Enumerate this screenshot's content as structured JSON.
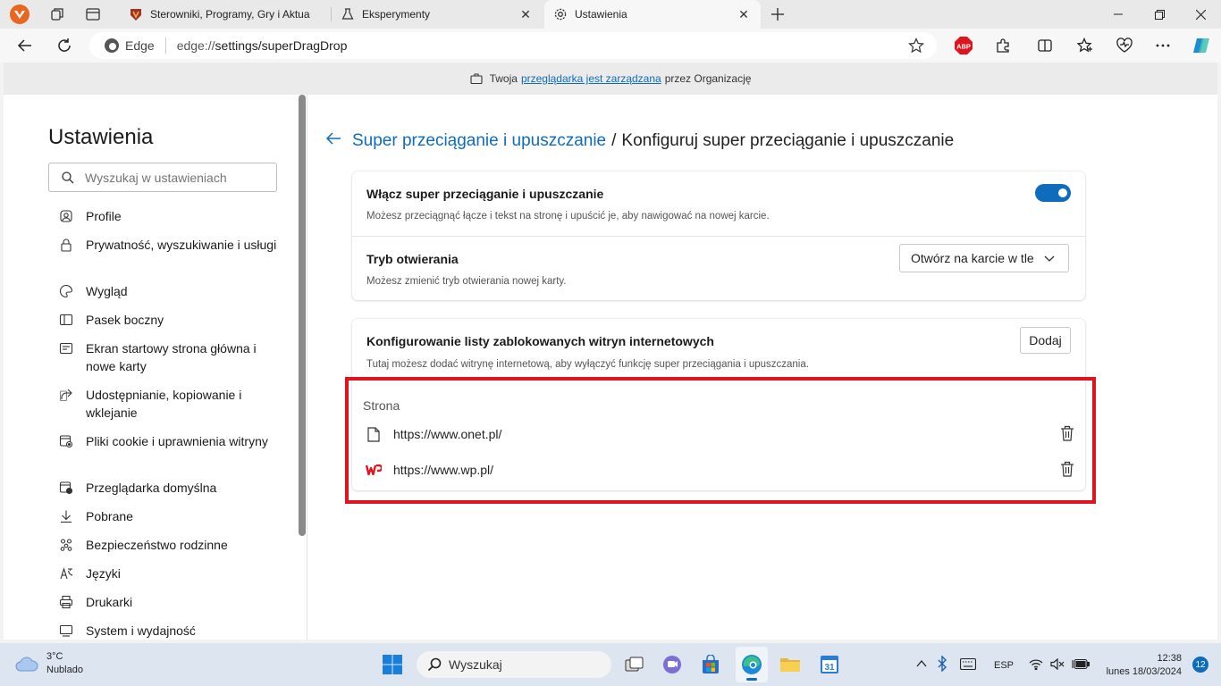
{
  "tabs": [
    {
      "title": "Sterowniki, Programy, Gry i Aktua",
      "icon": "shield-favicon"
    },
    {
      "title": "Eksperymenty",
      "icon": "flask-icon"
    },
    {
      "title": "Ustawienia",
      "icon": "gear-icon"
    }
  ],
  "toolbar": {
    "edge_label": "Edge",
    "url_prefix": "edge://",
    "url_path": "settings/superDragDrop",
    "abp_label": "ABP"
  },
  "banner": {
    "before": "Twoja",
    "link": "przeglądarka jest zarządzana",
    "after": "przez Organizację"
  },
  "sidebar": {
    "title": "Ustawienia",
    "search_placeholder": "Wyszukaj w ustawieniach",
    "items": [
      {
        "label": "Profile",
        "icon": "profile-icon"
      },
      {
        "label": "Prywatność, wyszukiwanie i usługi",
        "icon": "lock-icon"
      },
      {
        "label": "Wygląd",
        "icon": "appearance-icon"
      },
      {
        "label": "Pasek boczny",
        "icon": "sidebar-icon"
      },
      {
        "label": "Ekran startowy strona główna i nowe karty",
        "icon": "home-icon"
      },
      {
        "label": "Udostępnianie, kopiowanie i wklejanie",
        "icon": "share-icon"
      },
      {
        "label": "Pliki cookie i uprawnienia witryny",
        "icon": "cookie-icon"
      },
      {
        "label": "Przeglądarka domyślna",
        "icon": "browser-icon"
      },
      {
        "label": "Pobrane",
        "icon": "download-icon"
      },
      {
        "label": "Bezpieczeństwo rodzinne",
        "icon": "family-icon"
      },
      {
        "label": "Języki",
        "icon": "language-icon"
      },
      {
        "label": "Drukarki",
        "icon": "printer-icon"
      },
      {
        "label": "System i wydajność",
        "icon": "system-icon"
      }
    ]
  },
  "main": {
    "breadcrumb_parent": "Super przeciąganie i upuszczanie",
    "breadcrumb_sep": "/",
    "breadcrumb_current": "Konfiguruj super przeciąganie i upuszczanie",
    "enable_title": "Włącz super przeciąganie i upuszczanie",
    "enable_desc": "Możesz przeciągnąć łącze i tekst na stronę i upuścić je, aby nawigować na nowej karcie.",
    "enable_on": true,
    "mode_title": "Tryb otwierania",
    "mode_desc": "Możesz zmienić tryb otwierania nowej karty.",
    "mode_value": "Otwórz na karcie w tle",
    "block_title": "Konfigurowanie listy zablokowanych witryn internetowych",
    "block_desc": "Tutaj możesz dodać witrynę internetową, aby wyłączyć funkcję super przeciągania i upuszczania.",
    "add_button": "Dodaj",
    "list_header": "Strona",
    "sites": [
      {
        "url": "https://www.onet.pl/",
        "icon": "page-icon"
      },
      {
        "url": "https://www.wp.pl/",
        "icon": "wp-logo-icon"
      }
    ]
  },
  "taskbar": {
    "temp": "3°C",
    "condition": "Nublado",
    "search_label": "Wyszukaj",
    "lang": "ESP",
    "time": "12:38",
    "date": "lunes 18/03/2024",
    "notifications": "12",
    "calendar_day": "31"
  },
  "colors": {
    "accent": "#0f6cbd",
    "highlight": "#e0141e"
  }
}
